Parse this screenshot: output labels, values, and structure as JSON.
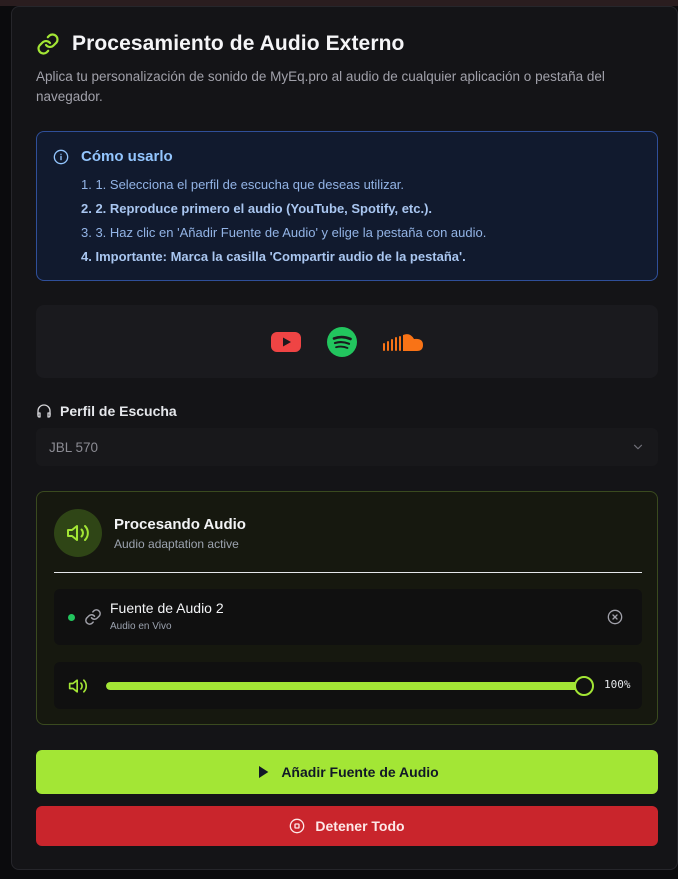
{
  "header": {
    "title": "Procesamiento de Audio Externo",
    "subtitle": "Aplica tu personalización de sonido de MyEq.pro al audio de cualquier aplicación o pestaña del navegador."
  },
  "info": {
    "title": "Cómo usarlo",
    "steps": [
      "1. 1. Selecciona el perfil de escucha que deseas utilizar.",
      "2. 2. Reproduce primero el audio (YouTube, Spotify, etc.).",
      "3. 3. Haz clic en 'Añadir Fuente de Audio' y elige la pestaña con audio.",
      "4. Importante: Marca la casilla 'Compartir audio de la pestaña'."
    ]
  },
  "logos": [
    "youtube-icon",
    "spotify-icon",
    "soundcloud-icon"
  ],
  "profile": {
    "label": "Perfil de Escucha",
    "selected": "JBL 570"
  },
  "processing": {
    "title": "Procesando Audio",
    "subtitle": "Audio adaptation active",
    "source": {
      "name": "Fuente de Audio 2",
      "status": "Audio en Vivo"
    },
    "volume": {
      "value": 100,
      "label": "100%"
    }
  },
  "buttons": {
    "add": "Añadir Fuente de Audio",
    "stop": "Detener Todo"
  },
  "colors": {
    "accent": "#a3e635",
    "danger": "#c9252c",
    "info": "#93c5fd",
    "live": "#22c55e"
  }
}
